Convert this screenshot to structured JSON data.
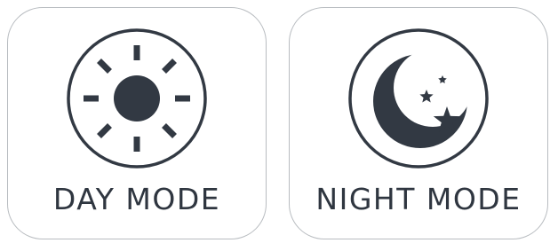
{
  "colors": {
    "icon": "#323943",
    "text": "#2f3640",
    "tile_border": "#b8bcc0",
    "background": "#ffffff"
  },
  "tiles": [
    {
      "id": "day",
      "label": "DAY MODE",
      "icon": "sun-icon"
    },
    {
      "id": "night",
      "label": "NIGHT MODE",
      "icon": "moon-stars-icon"
    }
  ]
}
